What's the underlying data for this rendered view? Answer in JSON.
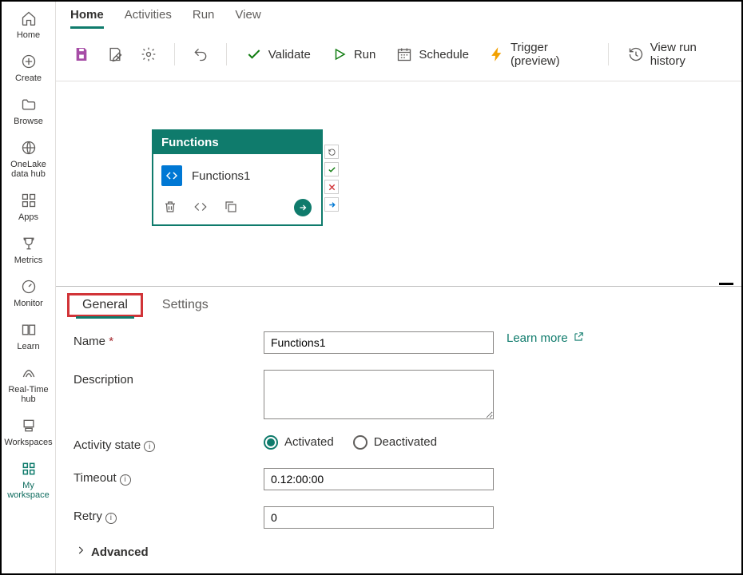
{
  "rail": {
    "items": [
      {
        "label": "Home"
      },
      {
        "label": "Create"
      },
      {
        "label": "Browse"
      },
      {
        "label": "OneLake data hub"
      },
      {
        "label": "Apps"
      },
      {
        "label": "Metrics"
      },
      {
        "label": "Monitor"
      },
      {
        "label": "Learn"
      },
      {
        "label": "Real-Time hub"
      },
      {
        "label": "Workspaces"
      },
      {
        "label": "My workspace"
      }
    ]
  },
  "tabs": {
    "home": "Home",
    "activities": "Activities",
    "run": "Run",
    "view": "View"
  },
  "toolbar": {
    "validate": "Validate",
    "run": "Run",
    "schedule": "Schedule",
    "trigger": "Trigger (preview)",
    "history": "View run history"
  },
  "node": {
    "header": "Functions",
    "title": "Functions1"
  },
  "propTabs": {
    "general": "General",
    "settings": "Settings"
  },
  "form": {
    "nameLabel": "Name",
    "nameValue": "Functions1",
    "learnMore": "Learn more",
    "descLabel": "Description",
    "descValue": "",
    "stateLabel": "Activity state",
    "stateActivated": "Activated",
    "stateDeactivated": "Deactivated",
    "timeoutLabel": "Timeout",
    "timeoutValue": "0.12:00:00",
    "retryLabel": "Retry",
    "retryValue": "0",
    "advanced": "Advanced"
  }
}
